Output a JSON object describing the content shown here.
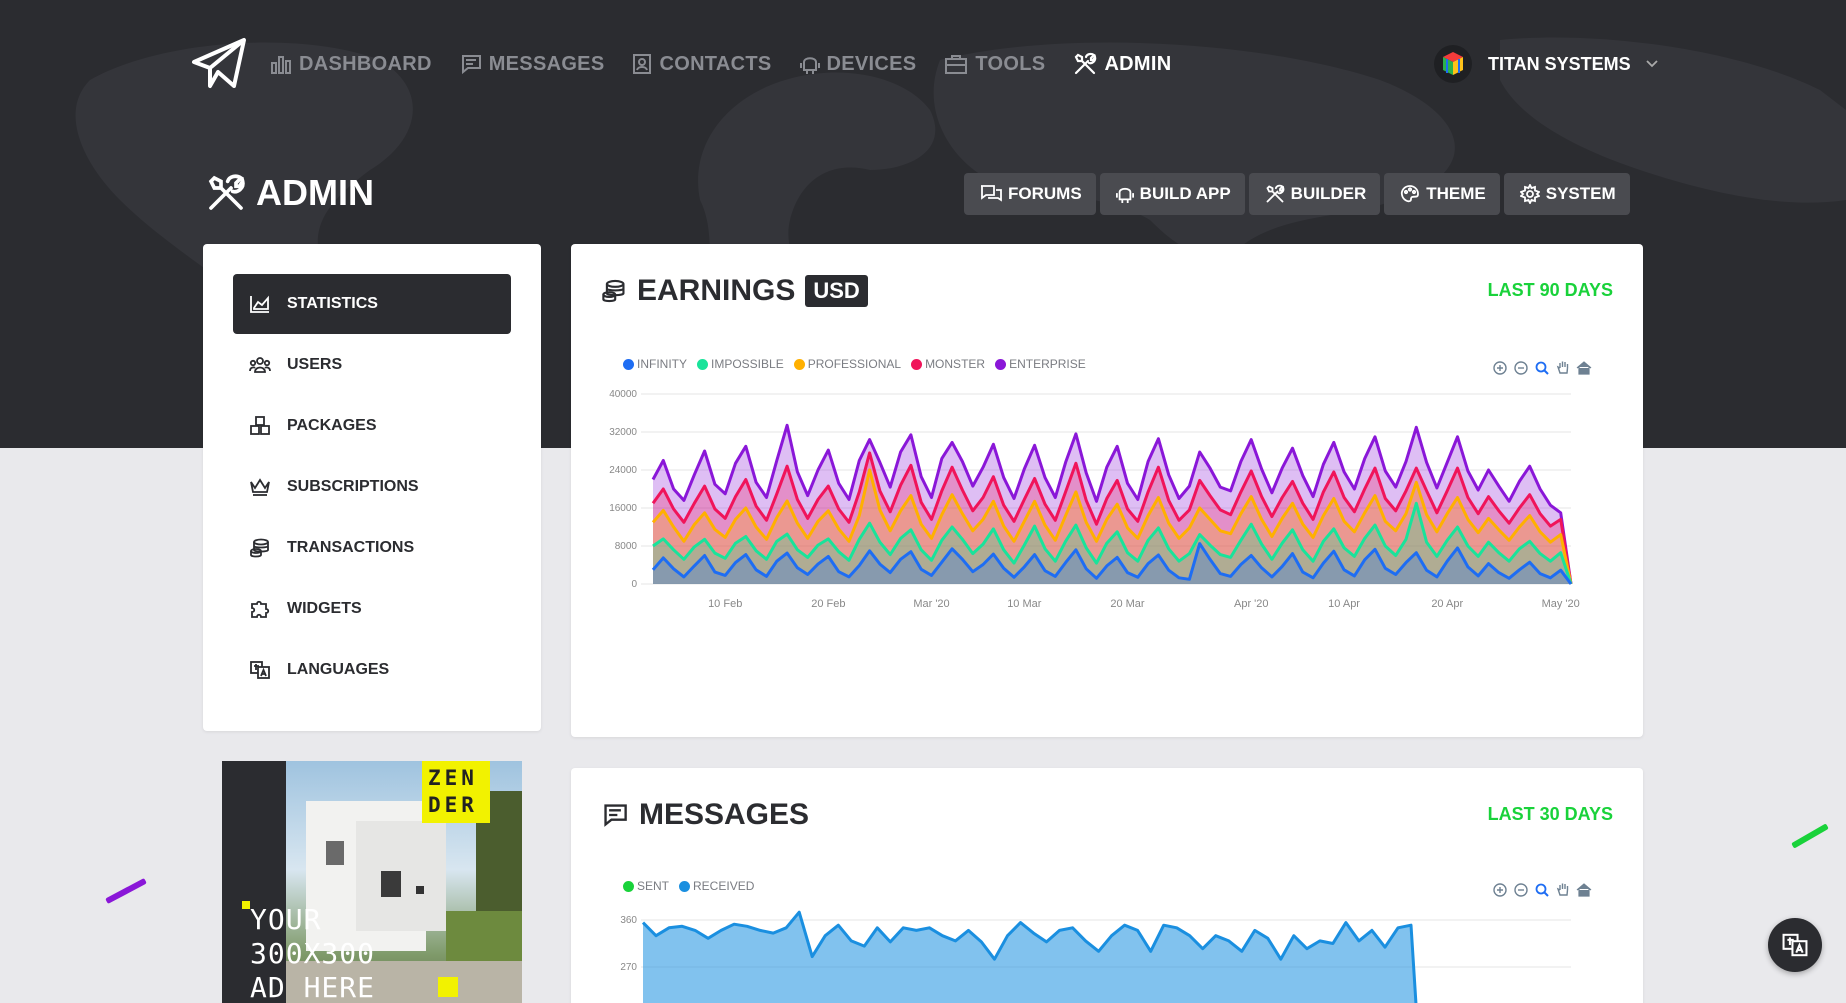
{
  "nav": {
    "items": [
      {
        "label": "DASHBOARD",
        "icon": "bar-chart-icon",
        "active": false
      },
      {
        "label": "MESSAGES",
        "icon": "message-icon",
        "active": false
      },
      {
        "label": "CONTACTS",
        "icon": "contact-card-icon",
        "active": false
      },
      {
        "label": "DEVICES",
        "icon": "android-icon",
        "active": false
      },
      {
        "label": "TOOLS",
        "icon": "toolbox-icon",
        "active": false
      },
      {
        "label": "ADMIN",
        "icon": "tools-icon",
        "active": true
      }
    ],
    "account_name": "TITAN SYSTEMS"
  },
  "page": {
    "title": "ADMIN",
    "tabs": [
      {
        "label": "FORUMS",
        "icon": "forums-icon"
      },
      {
        "label": "BUILD APP",
        "icon": "android-icon"
      },
      {
        "label": "BUILDER",
        "icon": "tools-icon"
      },
      {
        "label": "THEME",
        "icon": "palette-icon"
      },
      {
        "label": "SYSTEM",
        "icon": "gear-icon"
      }
    ]
  },
  "sidebar": {
    "items": [
      {
        "label": "STATISTICS",
        "icon": "chart-area-icon",
        "active": true
      },
      {
        "label": "USERS",
        "icon": "users-icon",
        "active": false
      },
      {
        "label": "PACKAGES",
        "icon": "packages-icon",
        "active": false
      },
      {
        "label": "SUBSCRIPTIONS",
        "icon": "crown-icon",
        "active": false
      },
      {
        "label": "TRANSACTIONS",
        "icon": "coins-icon",
        "active": false
      },
      {
        "label": "WIDGETS",
        "icon": "puzzle-icon",
        "active": false
      },
      {
        "label": "LANGUAGES",
        "icon": "language-icon",
        "active": false
      }
    ]
  },
  "ad": {
    "brand_line1": "ZEN",
    "brand_line2": "DER",
    "text_line1": "YOUR",
    "text_line2": "300X300",
    "text_line3": "AD HERE"
  },
  "earnings": {
    "title": "EARNINGS",
    "currency": "USD",
    "range": "LAST 90 DAYS"
  },
  "messages": {
    "title": "MESSAGES",
    "range": "LAST 30 DAYS"
  },
  "colors": {
    "accent_green": "#19d23a",
    "dark": "#2b2c30",
    "infinity": "#1e6df3",
    "impossible": "#19e39a",
    "professional": "#ffb000",
    "monster": "#f0145a",
    "enterprise": "#8a17d8",
    "sent": "#19d23a",
    "received": "#1a8fe0"
  },
  "chart_data": [
    {
      "type": "area",
      "title": "EARNINGS",
      "legend_position": "top-left",
      "grid": true,
      "ylim": [
        0,
        40000
      ],
      "y_ticks": [
        "40000",
        "32000",
        "24000",
        "16000",
        "8000",
        "0"
      ],
      "x_tick_labels": [
        "10 Feb",
        "20 Feb",
        "Mar '20",
        "10 Mar",
        "20 Mar",
        "Apr '20",
        "10 Apr",
        "20 Apr",
        "May '20"
      ],
      "x_start": "2020-02-03",
      "series": [
        {
          "name": "INFINITY",
          "color": "#1e6df3",
          "values": [
            3000,
            5500,
            3200,
            1500,
            3800,
            6000,
            2500,
            1800,
            4500,
            6200,
            3000,
            1600,
            4800,
            6500,
            3400,
            2000,
            4200,
            5800,
            2600,
            1500,
            3900,
            7000,
            4200,
            2400,
            5200,
            6800,
            3100,
            1800,
            4600,
            7400,
            5200,
            2600,
            4100,
            6300,
            3300,
            1400,
            3600,
            6200,
            2800,
            1600,
            4500,
            7200,
            3200,
            1200,
            3800,
            5600,
            2400,
            1400,
            4300,
            6100,
            2900,
            1300,
            1000,
            8500,
            5200,
            2200,
            1600,
            4100,
            6000,
            3400,
            1500,
            3700,
            6400,
            2500,
            1300,
            4400,
            6900,
            3000,
            1700,
            5100,
            7300,
            3300,
            2000,
            4500,
            6600,
            2900,
            1500,
            4800,
            7600,
            3600,
            1700,
            4300,
            2400,
            1200,
            3000,
            4600,
            2200,
            1300,
            2900,
            0
          ]
        },
        {
          "name": "IMPOSSIBLE",
          "color": "#19e39a",
          "values": [
            8000,
            9500,
            7200,
            5200,
            7800,
            9400,
            6500,
            5400,
            8600,
            10000,
            7000,
            5200,
            9000,
            10500,
            7200,
            5600,
            8200,
            9500,
            6800,
            5000,
            9400,
            12800,
            8800,
            6200,
            9600,
            11400,
            7200,
            5000,
            9200,
            12000,
            9400,
            6400,
            8400,
            11600,
            7200,
            4400,
            8200,
            12200,
            7400,
            4800,
            9000,
            12400,
            7600,
            4400,
            8600,
            11000,
            6600,
            4800,
            9200,
            11800,
            7400,
            4800,
            6400,
            10400,
            8200,
            6200,
            5600,
            9200,
            12600,
            8400,
            5200,
            8600,
            11400,
            7200,
            4800,
            9000,
            11600,
            7600,
            5800,
            9600,
            12400,
            8000,
            6000,
            9400,
            17000,
            8800,
            5800,
            9200,
            12000,
            8000,
            5800,
            8800,
            6600,
            4800,
            7400,
            9000,
            6400,
            4800,
            6600,
            0
          ]
        },
        {
          "name": "PROFESSIONAL",
          "color": "#ffb000",
          "values": [
            13000,
            15500,
            12000,
            9000,
            12500,
            15000,
            11500,
            9800,
            13600,
            16000,
            12000,
            9400,
            14000,
            17500,
            12800,
            9600,
            13200,
            15400,
            11600,
            9000,
            14400,
            24000,
            15600,
            11200,
            15400,
            18600,
            12600,
            9600,
            14600,
            18800,
            14800,
            11200,
            13600,
            17400,
            12200,
            9000,
            13200,
            17400,
            12400,
            9200,
            14400,
            19400,
            13000,
            9000,
            13600,
            16800,
            11800,
            9600,
            14400,
            18200,
            12800,
            9600,
            11800,
            16000,
            13600,
            11200,
            10600,
            14800,
            18400,
            13600,
            10000,
            13800,
            17000,
            12600,
            9800,
            14400,
            18000,
            13200,
            11000,
            15000,
            18600,
            13200,
            11200,
            14800,
            21400,
            14600,
            11000,
            14800,
            18200,
            13600,
            10800,
            13800,
            11400,
            9200,
            12000,
            14400,
            11000,
            8800,
            10400,
            0
          ]
        },
        {
          "name": "MONSTER",
          "color": "#f0145a",
          "values": [
            17000,
            20000,
            15800,
            13000,
            17000,
            20600,
            15800,
            13800,
            18400,
            22000,
            16400,
            13400,
            19000,
            24800,
            17800,
            13800,
            17800,
            20600,
            15800,
            13000,
            19400,
            27600,
            19600,
            15200,
            20800,
            25000,
            17200,
            13600,
            19600,
            24600,
            19800,
            15400,
            18200,
            22600,
            16600,
            13200,
            17800,
            22200,
            16800,
            13400,
            19400,
            25400,
            17600,
            12600,
            18000,
            21800,
            15800,
            13200,
            19400,
            24600,
            17600,
            13400,
            15600,
            21800,
            18600,
            15600,
            14600,
            19400,
            23800,
            18400,
            14200,
            18200,
            21600,
            17000,
            13600,
            19400,
            23600,
            18200,
            15200,
            20000,
            24400,
            18000,
            15400,
            19600,
            24400,
            19600,
            15000,
            19600,
            24400,
            18200,
            14800,
            18400,
            15400,
            12800,
            16000,
            18800,
            14800,
            12200,
            13600,
            0
          ]
        },
        {
          "name": "ENTERPRISE",
          "color": "#8a17d8",
          "values": [
            22000,
            26000,
            20000,
            17600,
            23000,
            28000,
            21000,
            19000,
            25400,
            29000,
            21400,
            18200,
            26000,
            33400,
            23600,
            18600,
            24000,
            28200,
            21200,
            17800,
            26000,
            30400,
            25600,
            20400,
            27800,
            31400,
            22600,
            18200,
            26400,
            29800,
            25800,
            20600,
            24600,
            29400,
            22400,
            18000,
            24200,
            29200,
            22400,
            18200,
            25600,
            31600,
            23400,
            17400,
            24600,
            29000,
            21200,
            17800,
            25800,
            30600,
            23000,
            18000,
            20600,
            27800,
            24400,
            20400,
            19600,
            25800,
            30400,
            24200,
            19200,
            24400,
            28600,
            22800,
            18400,
            25200,
            29800,
            23600,
            20000,
            26400,
            31000,
            23800,
            20400,
            25800,
            33000,
            25600,
            20200,
            25600,
            31000,
            23800,
            19800,
            24000,
            20600,
            17400,
            21600,
            24800,
            20000,
            16600,
            15000,
            0
          ]
        }
      ]
    },
    {
      "type": "area",
      "title": "MESSAGES",
      "legend_position": "top-left",
      "grid": true,
      "y_ticks": [
        "360",
        "270"
      ],
      "series": [
        {
          "name": "SENT",
          "color": "#19d23a",
          "values": []
        },
        {
          "name": "RECEIVED",
          "color": "#1a8fe0",
          "values": [
            355,
            330,
            345,
            348,
            340,
            325,
            340,
            352,
            348,
            340,
            335,
            345,
            375,
            290,
            330,
            350,
            320,
            310,
            345,
            318,
            345,
            340,
            345,
            330,
            320,
            340,
            318,
            285,
            330,
            355,
            335,
            318,
            340,
            345,
            320,
            300,
            330,
            350,
            340,
            300,
            350,
            345,
            330,
            305,
            330,
            320,
            300,
            340,
            325,
            285,
            330,
            305,
            320,
            315,
            355,
            320,
            340,
            308,
            345,
            350
          ]
        }
      ]
    }
  ]
}
